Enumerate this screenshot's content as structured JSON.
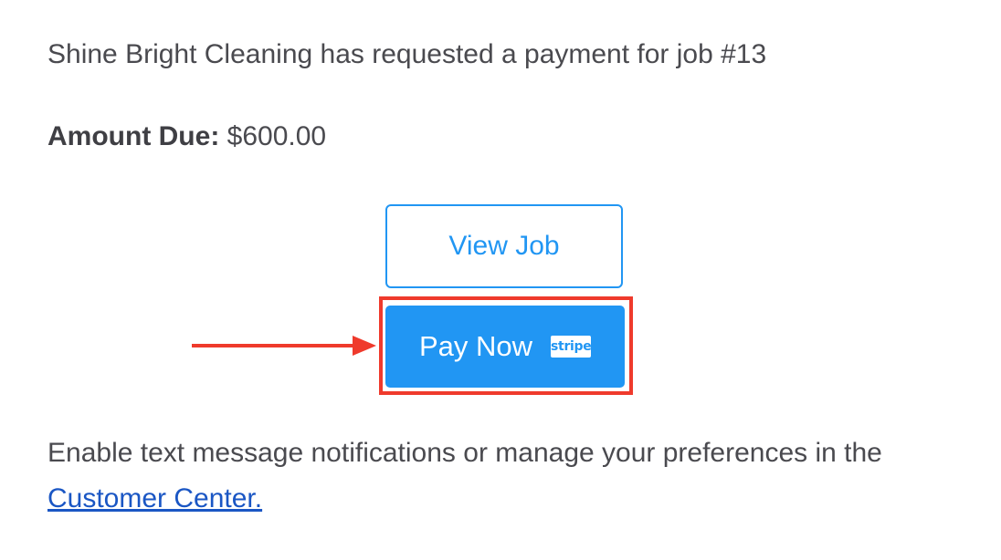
{
  "message": {
    "intro": "Shine Bright Cleaning has requested a payment for job #13",
    "amount_label": "Amount Due:",
    "amount_value": "$600.00"
  },
  "buttons": {
    "view_job": "View Job",
    "pay_now": "Pay Now",
    "stripe_badge": "stripe"
  },
  "footer": {
    "text": "Enable text message notifications or manage your preferences in the ",
    "link_text": "Customer Center."
  },
  "colors": {
    "primary": "#2196f3",
    "annotation": "#ef3a2c",
    "link": "#1a56c4",
    "text": "#4a4a4f"
  },
  "icons": {
    "annotation_arrow": "arrow-right-icon",
    "stripe": "stripe-logo-icon"
  }
}
